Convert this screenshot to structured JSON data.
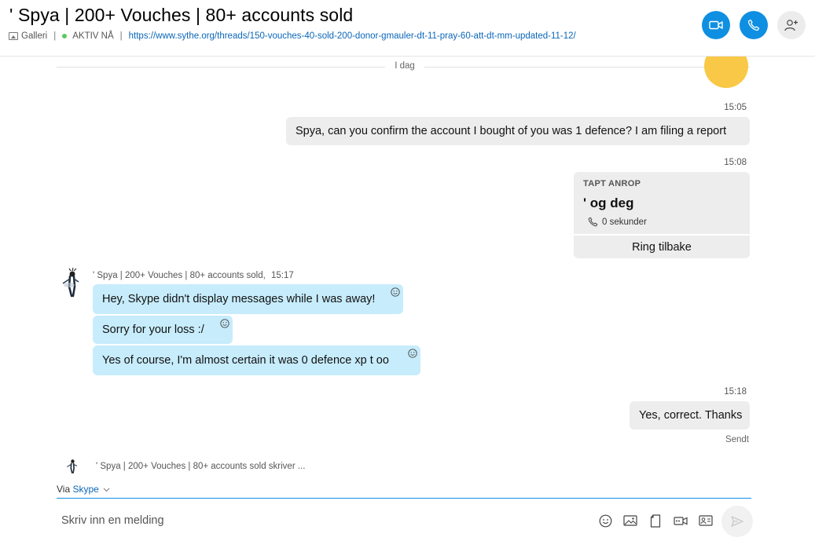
{
  "header": {
    "title": "' Spya | 200+ Vouches | 80+ accounts sold",
    "gallery_label": "Galleri",
    "status": "AKTIV NÅ",
    "link": "https://www.sythe.org/threads/150-vouches-40-sold-200-donor-gmauler-dt-11-pray-60-att-dt-mm-updated-11-12/",
    "video_call": "video-call",
    "audio_call": "audio-call",
    "add_person": "add-person"
  },
  "chat": {
    "day_label": "I dag",
    "msg1": {
      "time": "15:05",
      "text": "Spya, can you confirm the account I bought of you was 1 defence? I am filing a report"
    },
    "call": {
      "time": "15:08",
      "kind": "TAPT ANROP",
      "who": "' og deg",
      "duration": "0 sekunder",
      "callback": "Ring tilbake"
    },
    "incoming": {
      "sender": "' Spya | 200+ Vouches | 80+ accounts sold,",
      "time": "15:17",
      "messages": [
        "Hey, Skype didn't display messages while I was away!",
        "Sorry for your loss :/",
        "Yes of course, I'm almost certain it was 0 defence xp t oo"
      ]
    },
    "msg2": {
      "time": "15:18",
      "text": "Yes, correct. Thanks"
    },
    "sent_status": "Sendt",
    "typing": "' Spya | 200+ Vouches | 80+ accounts sold skriver ..."
  },
  "composer": {
    "via_label": "Via",
    "via_service": "Skype",
    "placeholder": "Skriv inn en melding"
  },
  "colors": {
    "accent": "#0f8fe1",
    "incoming_bubble": "#c7ecfc",
    "outgoing_bubble": "#ededed",
    "online": "#5cc95c"
  }
}
